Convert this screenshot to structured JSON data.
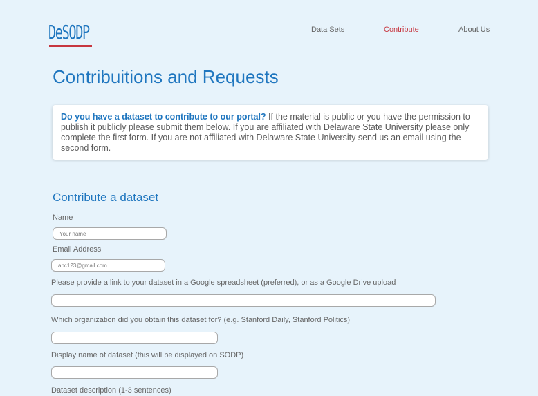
{
  "header": {
    "logo_text": "DeSODP",
    "nav": [
      {
        "label": "Data Sets"
      },
      {
        "label": "Contribute"
      },
      {
        "label": "About Us"
      }
    ]
  },
  "page": {
    "title": "Contribuitions and Requests"
  },
  "info": {
    "lead": "Do you have a dataset to contribute to our portal?",
    "body": "If the material is public or you have the permission to publish it publicly please submit them below. If you are affiliated with Delaware State University please only complete the first form. If you are not affiliated with Delaware State University send us an email using the second form."
  },
  "form": {
    "title": "Contribute a dataset",
    "name": {
      "label": "Name",
      "placeholder": "Your name"
    },
    "email": {
      "label": "Email Address",
      "placeholder": "abc123@gmail.com"
    },
    "link": {
      "label": "Please provide a link to your dataset in a Google spreadsheet (preferred), or as a Google Drive upload",
      "value": ""
    },
    "organization": {
      "label": "Which organization did you obtain this dataset for? (e.g. Stanford Daily, Stanford Politics)",
      "value": ""
    },
    "display_name": {
      "label": "Display name of dataset (this will be displayed on SODP)",
      "value": ""
    },
    "description": {
      "label": "Dataset description (1-3 sentences)"
    }
  },
  "colors": {
    "background": "#e7f3fb",
    "accent": "#1f76bf",
    "active_nav": "#c7363f"
  }
}
